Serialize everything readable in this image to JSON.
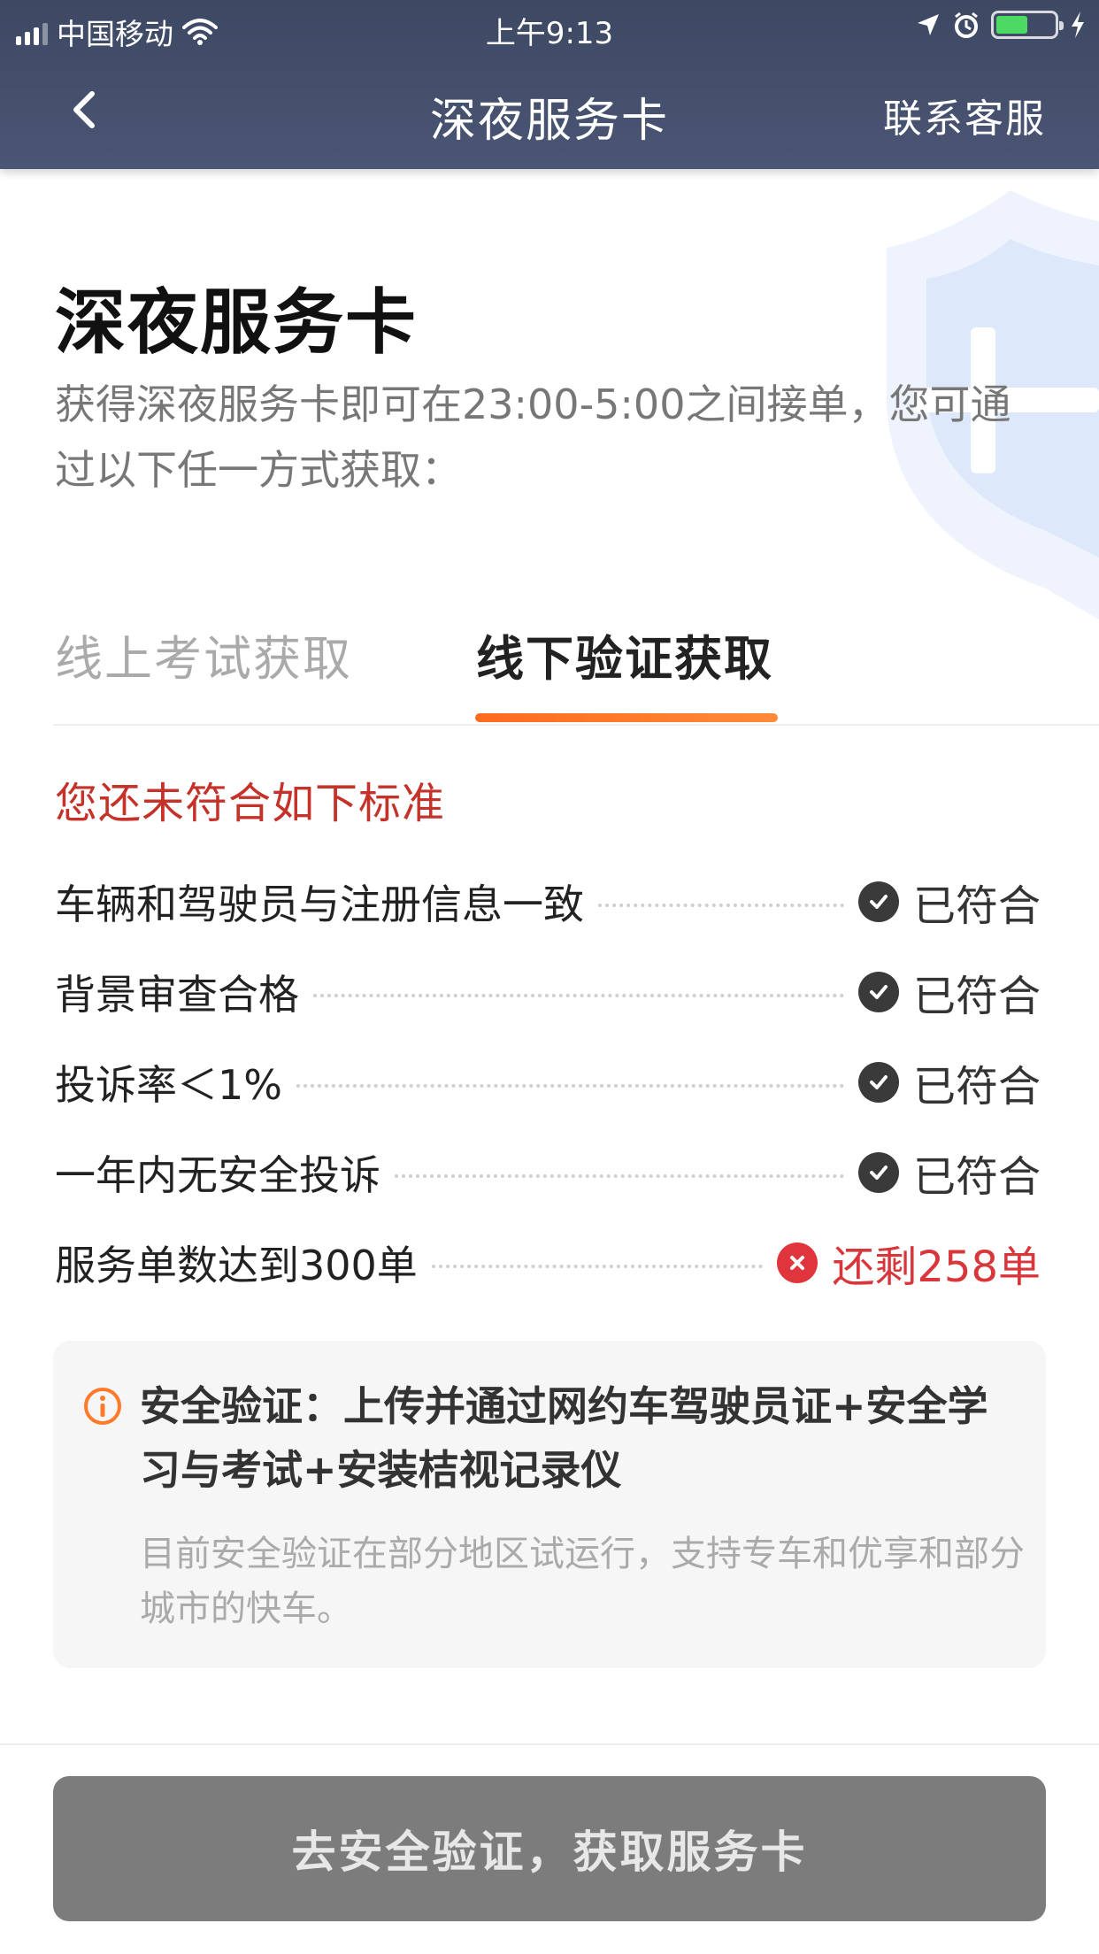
{
  "status_bar": {
    "carrier": "中国移动",
    "time": "上午9:13",
    "battery_level": 0.55,
    "battery_color": "#4cd964"
  },
  "nav": {
    "title": "深夜服务卡",
    "back_icon": "chevron-left-icon",
    "support_label": "联系客服"
  },
  "hero": {
    "title": "深夜服务卡",
    "description": "获得深夜服务卡即可在23:00-5:00之间接单，您可通过以下任一方式获取：",
    "decoration_icon": "shield-plus-icon"
  },
  "tabs": [
    {
      "label": "线上考试获取",
      "active": false
    },
    {
      "label": "线下验证获取",
      "active": true
    }
  ],
  "notice": "您还未符合如下标准",
  "criteria": [
    {
      "label": "车辆和驾驶员与注册信息一致",
      "status": "已符合",
      "met": true,
      "icon": "check-circle-icon"
    },
    {
      "label": "背景审查合格",
      "status": "已符合",
      "met": true,
      "icon": "check-circle-icon"
    },
    {
      "label": "投诉率＜1%",
      "status": "已符合",
      "met": true,
      "icon": "check-circle-icon"
    },
    {
      "label": "一年内无安全投诉",
      "status": "已符合",
      "met": true,
      "icon": "check-circle-icon"
    },
    {
      "label": "服务单数达到300单",
      "status": "还剩258单",
      "met": false,
      "icon": "x-circle-icon"
    }
  ],
  "info_box": {
    "icon": "info-icon",
    "title": "安全验证：上传并通过网约车驾驶员证+安全学习与考试+安装桔视记录仪",
    "note": "目前安全验证在部分地区试运行，支持专车和优享和部分城市的快车。"
  },
  "cta": {
    "label": "去安全验证，获取服务卡"
  },
  "colors": {
    "header_bg": "#3d4863",
    "accent_orange": "#ff6a1e",
    "error_red": "#d9363b",
    "cta_bg": "#7c7c7c"
  }
}
